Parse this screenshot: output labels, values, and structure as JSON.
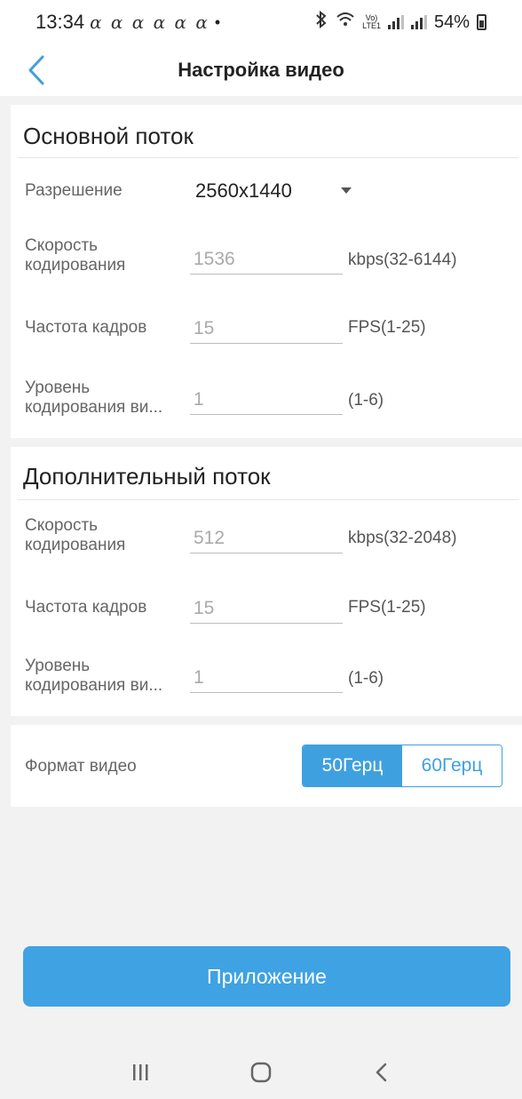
{
  "status_bar": {
    "time": "13:34",
    "notifications": "ɑ ɑ ɑ ɑ ɑ ɑ",
    "dot": "•",
    "battery": "54%",
    "network_tag_top": "Vo)",
    "network_tag_bottom": "LTE1"
  },
  "header": {
    "title": "Настройка видео"
  },
  "main_stream": {
    "title": "Основной поток",
    "resolution_label": "Разрешение",
    "resolution_value": "2560x1440",
    "bitrate_label_1": "Скорость",
    "bitrate_label_2": "кодирования",
    "bitrate_value": "1536",
    "bitrate_unit": "kbps(32-6144)",
    "fps_label": "Частота кадров",
    "fps_value": "15",
    "fps_unit": "FPS(1-25)",
    "quality_label_1": "Уровень",
    "quality_label_2": "кодирования ви...",
    "quality_value": "1",
    "quality_unit": "(1-6)"
  },
  "sub_stream": {
    "title": "Дополнительный поток",
    "bitrate_label_1": "Скорость",
    "bitrate_label_2": "кодирования",
    "bitrate_value": "512",
    "bitrate_unit": "kbps(32-2048)",
    "fps_label": "Частота кадров",
    "fps_value": "15",
    "fps_unit": "FPS(1-25)",
    "quality_label_1": "Уровень",
    "quality_label_2": "кодирования ви...",
    "quality_value": "1",
    "quality_unit": "(1-6)"
  },
  "video_format": {
    "label": "Формат видео",
    "options": [
      "50Герц",
      "60Герц"
    ],
    "selected": "50Герц"
  },
  "apply_button": "Приложение",
  "colors": {
    "accent": "#3fa0e0",
    "background": "#f2f2f2"
  }
}
